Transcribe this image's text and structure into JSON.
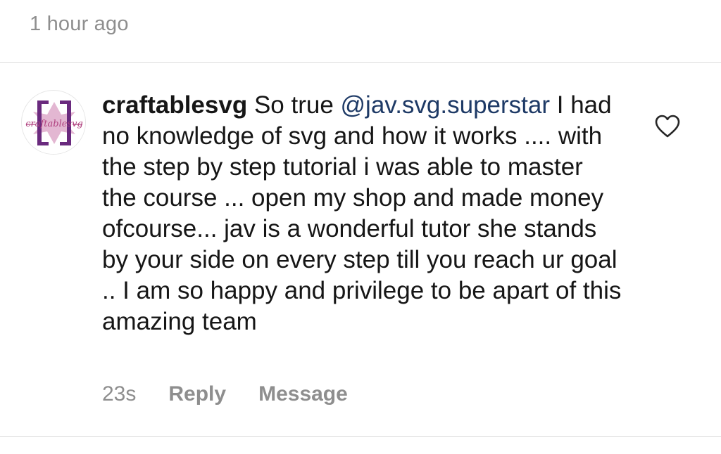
{
  "header": {
    "timestamp": "1 hour ago"
  },
  "comment": {
    "username": "craftablesvg",
    "text_before_mention": "So true ",
    "mention": "@jav.svg.superstar",
    "body": "I had no knowledge of svg and how it works .... with the step by step tutorial i was able to master the course ... open my shop and made money ofcourse... jav is a wonderful tutor she stands by your side on every step  till you reach ur goal .. I am so happy and privilege to be apart of this amazing team",
    "avatar_text": "craftablesvg",
    "like_icon": "heart-outline-icon"
  },
  "meta": {
    "age": "23s",
    "reply_label": "Reply",
    "message_label": "Message"
  },
  "colors": {
    "mention": "#1e3a66",
    "muted": "#8e8e8e",
    "avatar_purple": "#6a2a7e",
    "avatar_pink": "#d9a6c4"
  }
}
